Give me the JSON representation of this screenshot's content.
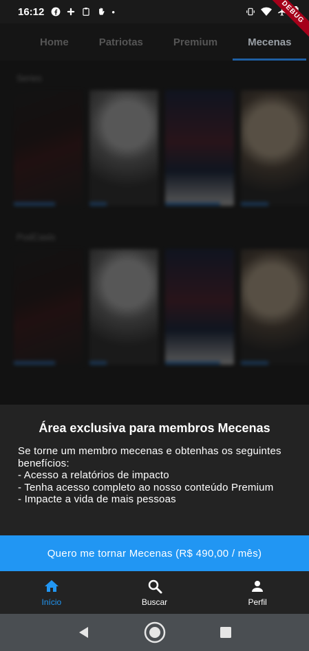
{
  "status_bar": {
    "time": "16:12",
    "debug_label": "DEBUG"
  },
  "tabs": [
    {
      "label": "Home",
      "active": false
    },
    {
      "label": "Patriotas",
      "active": false
    },
    {
      "label": "Premium",
      "active": false
    },
    {
      "label": "Mecenas",
      "active": true
    }
  ],
  "sections": [
    {
      "title": "Series"
    },
    {
      "title": "PodCasts"
    }
  ],
  "card": {
    "title": "Área exclusiva para membros Mecenas",
    "description": "Se torne um membro mecenas e obtenhas os seguintes benefícios:\n- Acesso a relatórios de impacto\n- Tenha acesso completo ao nosso conteúdo Premium\n- Impacte a vida de mais pessoas"
  },
  "cta": {
    "label": "Quero me tornar Mecenas (R$ 490,00 / mês)"
  },
  "bottom_nav": [
    {
      "label": "Início",
      "icon": "home-icon",
      "active": true
    },
    {
      "label": "Buscar",
      "icon": "search-icon",
      "active": false
    },
    {
      "label": "Perfil",
      "icon": "person-icon",
      "active": false
    }
  ],
  "colors": {
    "accent": "#2196f3",
    "card_bg": "#232323",
    "debug_ribbon": "#a5001a"
  }
}
